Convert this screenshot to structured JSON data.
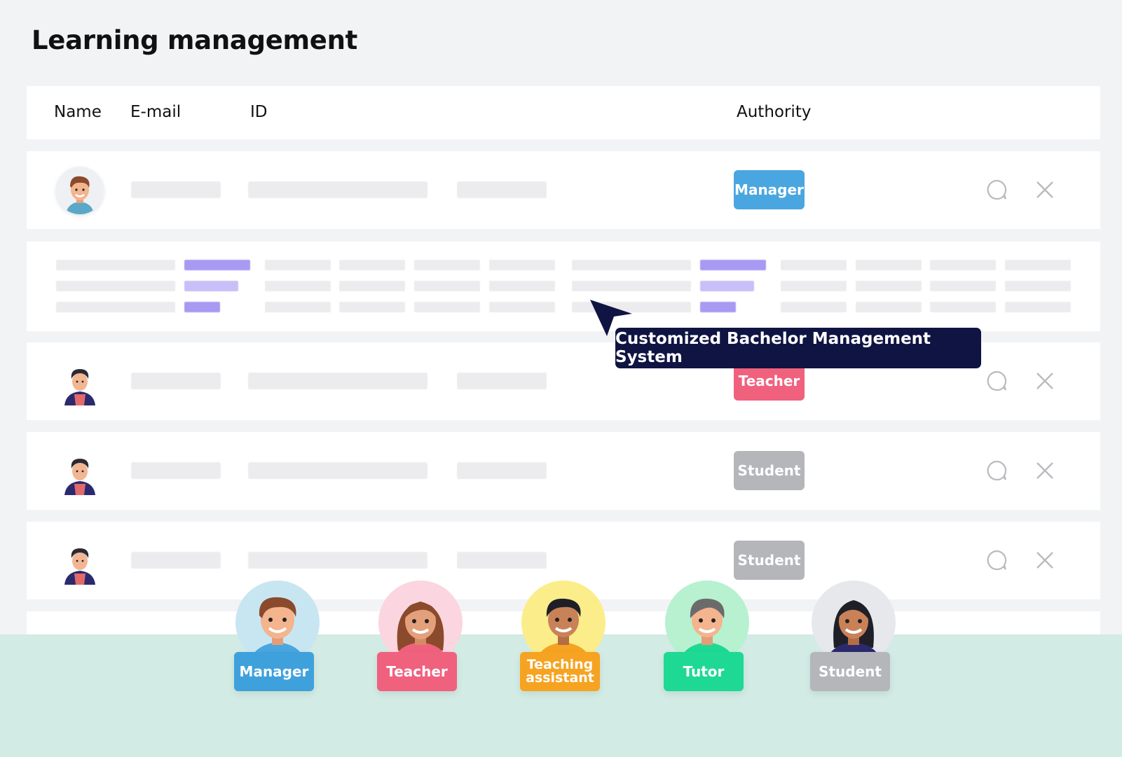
{
  "page": {
    "title": "Learning management"
  },
  "table": {
    "headers": {
      "name": "Name",
      "email": "E-mail",
      "id": "ID",
      "authority": "Authority"
    },
    "rows": [
      {
        "authority": "Manager",
        "color": "#4aa6e0"
      },
      {
        "authority": "Teacher",
        "color": "#f0617e"
      },
      {
        "authority": "Student",
        "color": "#b4b6ba"
      },
      {
        "authority": "Student",
        "color": "#b4b6ba"
      }
    ]
  },
  "tooltip": {
    "text": "Customized Bachelor Management System"
  },
  "roles": [
    {
      "label": "Manager",
      "color": "#3fa1dc",
      "bg": "#c8e6f2"
    },
    {
      "label": "Teacher",
      "color": "#f0617e",
      "bg": "#fbd5df"
    },
    {
      "label": "Teaching assistant",
      "color": "#f6a321",
      "bg": "#fbed8a"
    },
    {
      "label": "Tutor",
      "color": "#1ed994",
      "bg": "#b7f1cf"
    },
    {
      "label": "Student",
      "color": "#b4b6ba",
      "bg": "#e6e8ec"
    }
  ],
  "icons": [
    "chat-icon",
    "close-icon",
    "cursor-arrow-icon"
  ]
}
